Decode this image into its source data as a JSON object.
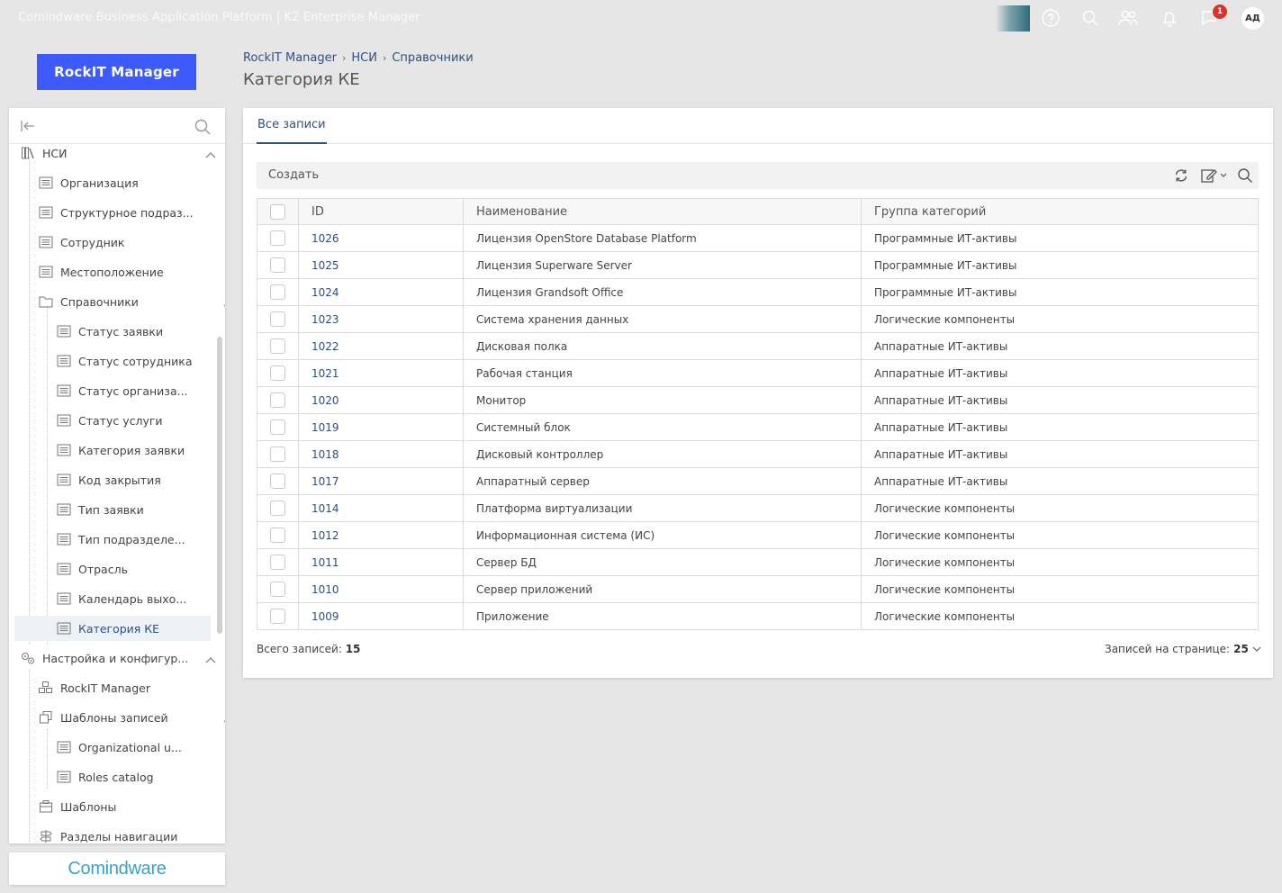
{
  "app": {
    "title": "Comindware Business Application Platform  |  K2 Enterprise Manager",
    "notifications_count": "1",
    "avatar_initials": "АД",
    "logo_text": "RockIT Manager",
    "footer_brand": "Comindware"
  },
  "breadcrumb": {
    "items": [
      "RockIT Manager",
      "НСИ",
      "Справочники"
    ]
  },
  "page": {
    "title": "Категория КЕ"
  },
  "sidebar": {
    "items": [
      {
        "label": "НСИ"
      },
      {
        "label": "Организация"
      },
      {
        "label": "Структурное подраз..."
      },
      {
        "label": "Сотрудник"
      },
      {
        "label": "Местоположение"
      },
      {
        "label": "Справочники"
      },
      {
        "label": "Статус заявки"
      },
      {
        "label": "Статус сотрудника"
      },
      {
        "label": "Статус организа..."
      },
      {
        "label": "Статус услуги"
      },
      {
        "label": "Категория заявки"
      },
      {
        "label": "Код закрытия"
      },
      {
        "label": "Тип заявки"
      },
      {
        "label": "Тип подразделе..."
      },
      {
        "label": "Отрасль"
      },
      {
        "label": "Календарь выхо..."
      },
      {
        "label": "Категория КЕ"
      },
      {
        "label": "Настройка и конфигур..."
      },
      {
        "label": "RockIT Manager"
      },
      {
        "label": "Шаблоны записей"
      },
      {
        "label": "Organizational u..."
      },
      {
        "label": "Roles catalog"
      },
      {
        "label": "Шаблоны"
      },
      {
        "label": "Разделы навигации"
      }
    ]
  },
  "main": {
    "tab_label": "Все записи",
    "create_label": "Создать",
    "columns": [
      "ID",
      "Наименование",
      "Группа категорий"
    ],
    "rows": [
      {
        "id": "1026",
        "name": "Лицензия OpenStore Database Platform",
        "group": "Программные ИТ-активы"
      },
      {
        "id": "1025",
        "name": "Лицензия Superware Server",
        "group": "Программные ИТ-активы"
      },
      {
        "id": "1024",
        "name": "Лицензия Grandsoft Office",
        "group": "Программные ИТ-активы"
      },
      {
        "id": "1023",
        "name": "Система хранения данных",
        "group": "Логические компоненты"
      },
      {
        "id": "1022",
        "name": "Дисковая полка",
        "group": "Аппаратные ИТ-активы"
      },
      {
        "id": "1021",
        "name": "Рабочая станция",
        "group": "Аппаратные ИТ-активы"
      },
      {
        "id": "1020",
        "name": "Монитор",
        "group": "Аппаратные ИТ-активы"
      },
      {
        "id": "1019",
        "name": "Системный блок",
        "group": "Аппаратные ИТ-активы"
      },
      {
        "id": "1018",
        "name": "Дисковый контроллер",
        "group": "Аппаратные ИТ-активы"
      },
      {
        "id": "1017",
        "name": "Аппаратный сервер",
        "group": "Аппаратные ИТ-активы"
      },
      {
        "id": "1014",
        "name": "Платформа виртуализации",
        "group": "Логические компоненты"
      },
      {
        "id": "1012",
        "name": "Информационная система (ИС)",
        "group": "Логические компоненты"
      },
      {
        "id": "1011",
        "name": "Сервер БД",
        "group": "Логические компоненты"
      },
      {
        "id": "1010",
        "name": "Сервер приложений",
        "group": "Логические компоненты"
      },
      {
        "id": "1009",
        "name": "Приложение",
        "group": "Логические компоненты"
      }
    ],
    "total_label": "Всего записей:",
    "total_value": "15",
    "per_page_label": "Записей на странице:",
    "per_page_value": "25"
  },
  "colors": {
    "accent": "#2f4f7f",
    "logo_bg": "#3d5afe",
    "badge": "#d9342b"
  }
}
